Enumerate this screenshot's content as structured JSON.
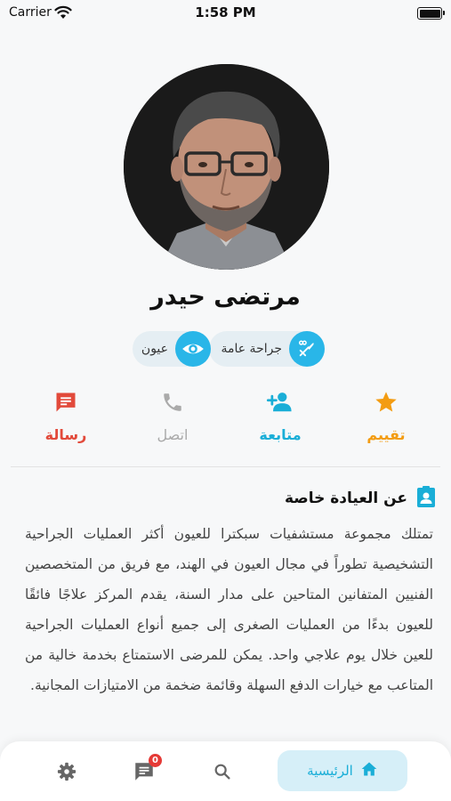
{
  "status_bar": {
    "carrier": "Carrier",
    "time": "1:58 PM"
  },
  "profile": {
    "name": "مرتضى حيدر"
  },
  "specialties": [
    {
      "label": "جراحة عامة",
      "icon": "scalpel-icon"
    },
    {
      "label": "عيون",
      "icon": "eye-icon"
    }
  ],
  "actions": {
    "rate": {
      "label": "تقييم",
      "icon": "star-icon",
      "color": "#f39c12"
    },
    "follow": {
      "label": "متابعة",
      "icon": "person-add-icon",
      "color": "#1aaed7"
    },
    "call": {
      "label": "اتصل",
      "icon": "phone-icon",
      "color": "#aaaaaa"
    },
    "message": {
      "label": "رسالة",
      "icon": "message-icon",
      "color": "#e24a3b"
    }
  },
  "about": {
    "title": "عن العيادة خاصة",
    "icon": "contact-card-icon",
    "text": "تمتلك مجموعة مستشفيات سبكترا للعيون أكثر العمليات الجراحية التشخيصية تطوراً في مجال العيون في الهند، مع فريق من المتخصصين الفنيين المتفانين المتاحين على مدار السنة، يقدم المركز علاجًا فائقًا للعيون بدءًا من العمليات الصغرى إلى جميع أنواع العمليات الجراحية للعين خلال يوم علاجي واحد. يمكن للمرضى الاستمتاع بخدمة خالية من المتاعب مع خيارات الدفع السهلة وقائمة ضخمة من الامتيازات المجانية."
  },
  "tabbar": {
    "home_label": "الرئيسية",
    "chat_badge": "0",
    "accent": "#1aaed7"
  }
}
